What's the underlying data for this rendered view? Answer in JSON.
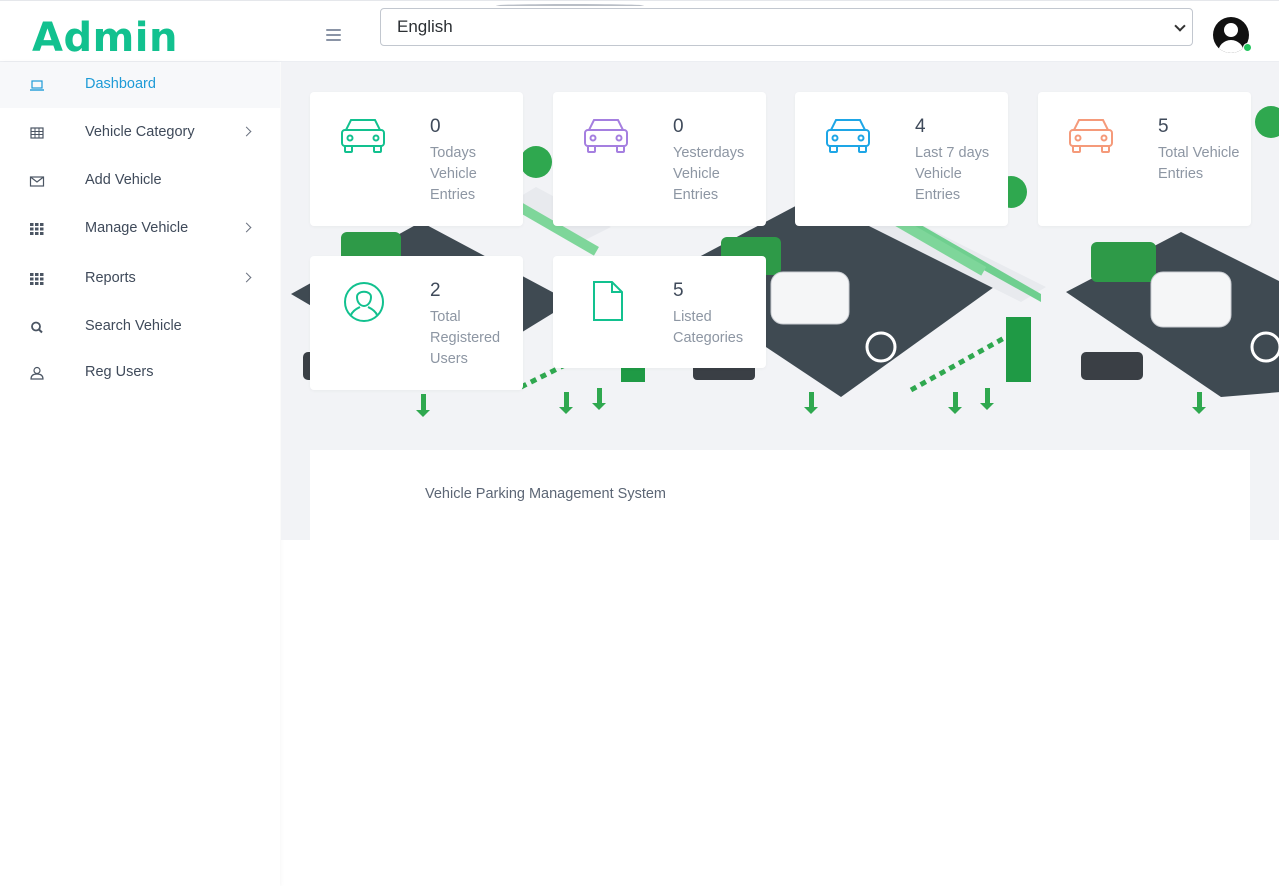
{
  "header": {
    "brand": "Admin",
    "language": {
      "selected": "English"
    }
  },
  "sidebar": {
    "items": [
      {
        "label": "Dashboard",
        "icon": "laptop-icon",
        "active": true
      },
      {
        "label": "Vehicle Category",
        "icon": "table-icon",
        "submenu": true
      },
      {
        "label": "Add Vehicle",
        "icon": "envelope-icon"
      },
      {
        "label": "Manage Vehicle",
        "icon": "grid-icon",
        "submenu": true
      },
      {
        "label": "Reports",
        "icon": "grid-icon",
        "submenu": true
      },
      {
        "label": "Search Vehicle",
        "icon": "search-icon"
      },
      {
        "label": "Reg Users",
        "icon": "user-icon"
      }
    ]
  },
  "stats": [
    {
      "value": "0",
      "label": "Todays Vehicle Entries",
      "icon": "car-icon",
      "color": "#12c18f"
    },
    {
      "value": "0",
      "label": "Yesterdays Vehicle Entries",
      "icon": "car-icon",
      "color": "#a57fe0"
    },
    {
      "value": "4",
      "label": "Last 7 days Vehicle Entries",
      "icon": "car-icon",
      "color": "#1ea6e6"
    },
    {
      "value": "5",
      "label": "Total Vehicle Entries",
      "icon": "car-icon",
      "color": "#f59a7a"
    },
    {
      "value": "2",
      "label": "Total Registered Users",
      "icon": "user-circle-icon",
      "color": "#12c18f"
    },
    {
      "value": "5",
      "label": "Listed Categories",
      "icon": "document-icon",
      "color": "#12c18f"
    }
  ],
  "footer_panel": {
    "text": "Vehicle Parking Management System"
  }
}
